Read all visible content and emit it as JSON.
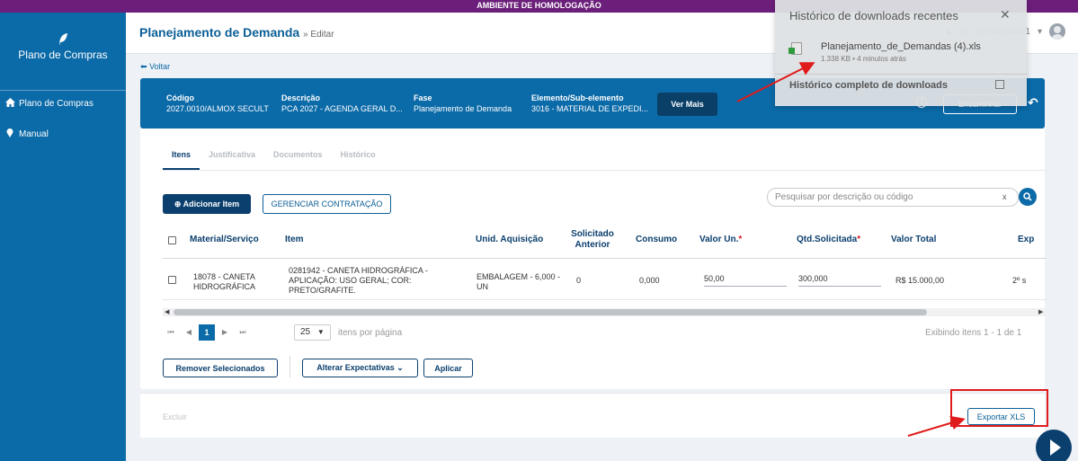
{
  "env_banner": "AMBIENTE DE HOMOLOGAÇÃO",
  "sidebar": {
    "logo_text": "Plano de Compras",
    "items": [
      {
        "label": "Plano de Compras",
        "icon": "home-icon"
      },
      {
        "label": "Manual",
        "icon": "info-pin-icon"
      }
    ]
  },
  "header": {
    "title": "Planejamento de Demanda",
    "subtitle": "» Editar",
    "user": "demandante1",
    "back_label": "Voltar"
  },
  "info_band": {
    "codigo_label": "Código",
    "codigo_value": "2027.0010/ALMOX SECULT",
    "descricao_label": "Descrição",
    "descricao_value": "PCA 2027 - AGENDA GERAL D...",
    "fase_label": "Fase",
    "fase_value": "Planejamento de Demanda",
    "elemento_label": "Elemento/Sub-elemento",
    "elemento_value": "3016 - MATERIAL DE EXPEDI...",
    "ver_mais": "Ver Mais",
    "encaminhar": "Encaminhar"
  },
  "tabs": [
    "Itens",
    "Justificativa",
    "Documentos",
    "Histórico"
  ],
  "toolbar": {
    "add_item": "Adicionar Item",
    "gerenciar": "GERENCIAR CONTRATAÇÃO",
    "search_placeholder": "Pesquisar por descrição ou código"
  },
  "table": {
    "columns": [
      "Material/Serviço",
      "Item",
      "Unid. Aquisição",
      "Solicitado Anterior",
      "Consumo",
      "Valor Un.",
      "Qtd.Solicitada",
      "Valor Total",
      "Exp"
    ],
    "rows": [
      {
        "material": "18078 - CANETA HIDROGRÁFICA",
        "item": "0281942 - CANETA HIDROGRÁFICA - APLICAÇÃO: USO GERAL; COR: PRETO/GRAFITE.",
        "unid": "EMBALAGEM - 6,000 - UN",
        "solicitado_anterior": "0",
        "consumo": "0,000",
        "valor_un": "50,00",
        "qtd_solicitada": "300,000",
        "valor_total": "R$ 15.000,00",
        "exp": "2º s"
      }
    ]
  },
  "pagination": {
    "current_page": "1",
    "per_page": "25",
    "per_page_label": "itens por página",
    "summary": "Exibindo itens 1 - 1 de 1"
  },
  "actions": {
    "remover": "Remover Selecionados",
    "alterar": "Alterar Expectativas",
    "aplicar": "Aplicar",
    "excluir": "Excluir",
    "exportar": "Exportar XLS"
  },
  "downloads_panel": {
    "title": "Histórico de downloads recentes",
    "file_name": "Planejamento_de_Demandas (4).xls",
    "file_meta": "1.338 KB • 4 minutos atrás",
    "history_link": "Histórico completo de downloads"
  },
  "colors": {
    "primary": "#0b6aa8",
    "dark_primary": "#0b3f6e",
    "env_banner": "#6b1f7a",
    "annotation_red": "#e01b1b"
  }
}
